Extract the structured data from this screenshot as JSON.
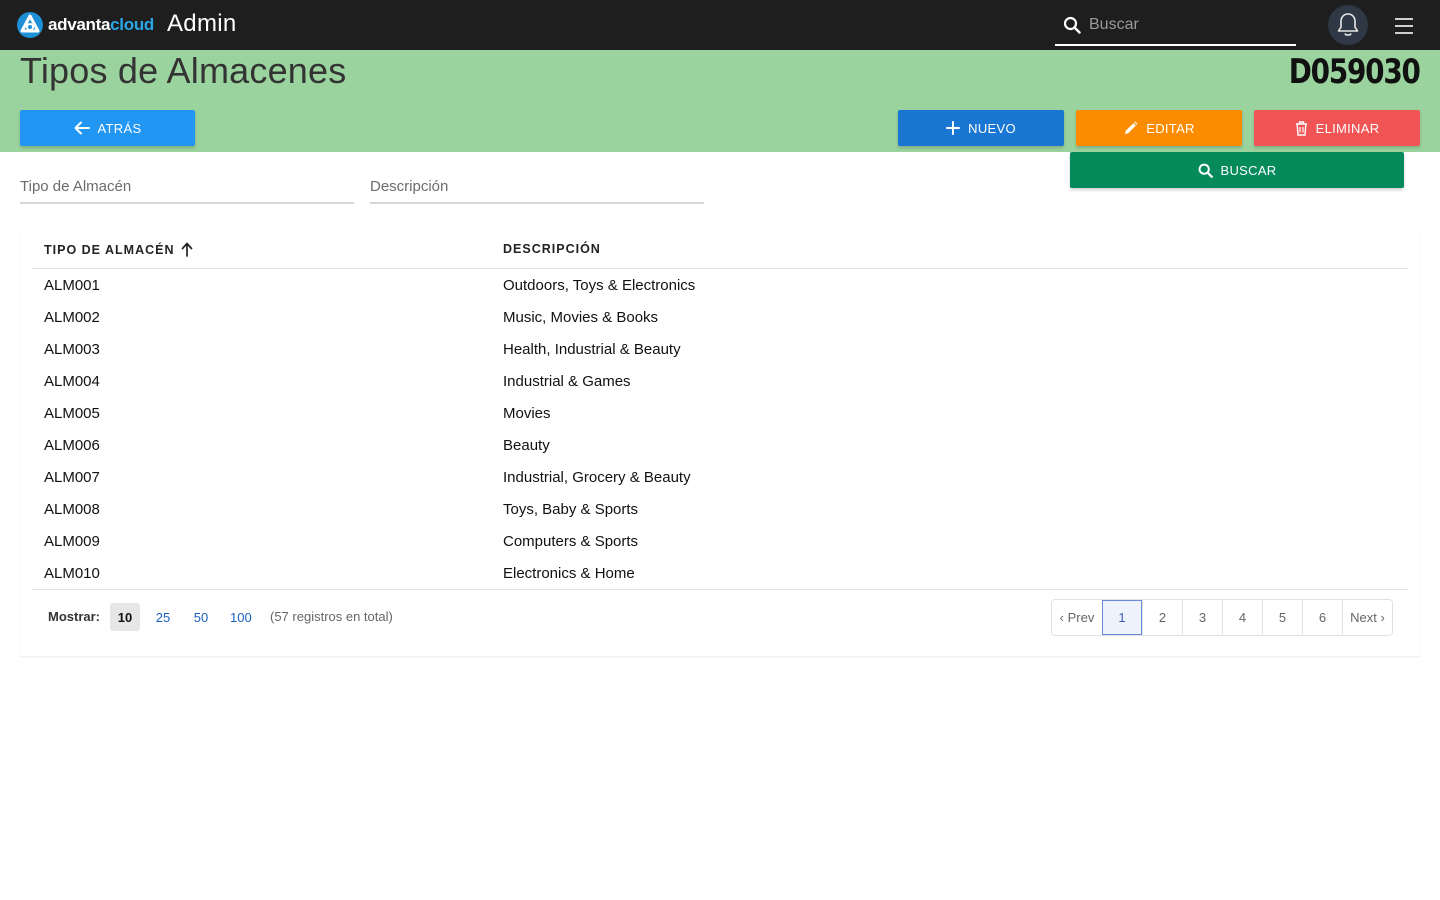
{
  "topbar": {
    "logo_part1": "advanta",
    "logo_part2": "cloud",
    "app_title": "Admin",
    "search_placeholder": "Buscar",
    "icons": [
      "logo-icon",
      "search-icon",
      "bell-icon",
      "hamburger-menu-icon"
    ]
  },
  "header": {
    "title": "Tipos de Almacenes",
    "code": "D059030",
    "bg_color": "#9bd39e"
  },
  "buttons": {
    "back": "ATRÁS",
    "new": "NUEVO",
    "edit": "EDITAR",
    "delete": "ELIMINAR",
    "search": "BUSCAR",
    "colors": {
      "back": "#2196f3",
      "new": "#1976d2",
      "edit": "#fb8c00",
      "delete": "#f05454",
      "search": "#058b5b"
    }
  },
  "filters": {
    "type_placeholder": "Tipo de Almacén",
    "type_value": "",
    "desc_placeholder": "Descripción",
    "desc_value": ""
  },
  "table": {
    "columns": [
      "TIPO DE ALMACÉN",
      "DESCRIPCIÓN"
    ],
    "sort": "ascending",
    "rows": [
      {
        "type": "ALM001",
        "desc": "Outdoors, Toys & Electronics"
      },
      {
        "type": "ALM002",
        "desc": "Music, Movies & Books"
      },
      {
        "type": "ALM003",
        "desc": "Health, Industrial & Beauty"
      },
      {
        "type": "ALM004",
        "desc": "Industrial & Games"
      },
      {
        "type": "ALM005",
        "desc": "Movies"
      },
      {
        "type": "ALM006",
        "desc": "Beauty"
      },
      {
        "type": "ALM007",
        "desc": "Industrial, Grocery & Beauty"
      },
      {
        "type": "ALM008",
        "desc": "Toys, Baby & Sports"
      },
      {
        "type": "ALM009",
        "desc": "Computers & Sports"
      },
      {
        "type": "ALM010",
        "desc": "Electronics & Home"
      }
    ]
  },
  "footer": {
    "show_label": "Mostrar:",
    "page_sizes": [
      "10",
      "25",
      "50",
      "100"
    ],
    "active_size": "10",
    "total_text": "(57 registros en total)",
    "pager": {
      "prev": "‹ Prev",
      "pages": [
        "1",
        "2",
        "3",
        "4",
        "5",
        "6"
      ],
      "active_page": "1",
      "next": "Next ›"
    }
  }
}
